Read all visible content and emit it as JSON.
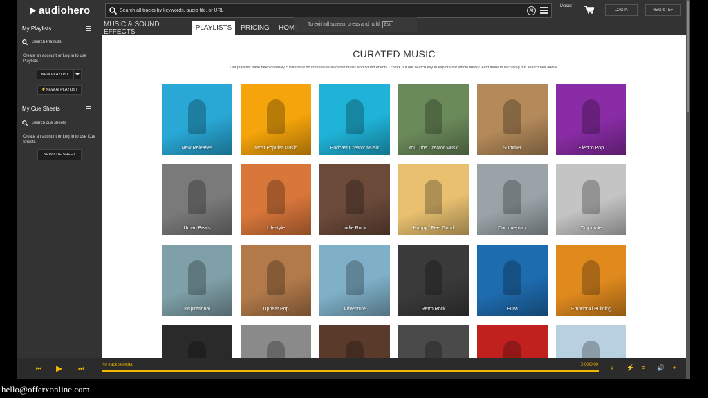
{
  "header": {
    "logo": "audiohero",
    "search_placeholder": "Search all tracks by keywords, audio file, or URL",
    "ai_label": "AI",
    "moods": "Moods",
    "login": "LOG IN",
    "register": "REGISTER"
  },
  "nav": {
    "tabs": [
      "MUSIC & SOUND EFFECTS",
      "PLAYLISTS",
      "PRICING",
      "HOME"
    ],
    "active": "PLAYLISTS"
  },
  "fullscreen_notice": {
    "text": "To exit full screen, press and hold",
    "key": "Esc"
  },
  "sidebar": {
    "playlists_title": "My Playlists",
    "playlists_search_placeholder": "Search Playlists",
    "playlists_text": "Create an account or Log in to use Playlists",
    "new_playlist": "NEW PLAYLIST",
    "new_ai_playlist": "NEW AI PLAYLIST",
    "cuesheets_title": "My Cue Sheets",
    "cuesheets_search_placeholder": "Search cue sheets",
    "cuesheets_text": "Create an account or Log in to use Cue Sheets",
    "new_cue_sheet": "NEW CUE SHEET"
  },
  "main": {
    "title": "CURATED MUSIC",
    "subtitle": "Our playlists have been carefully curated but do not include all of our music and sound effects - check out our search key to explore our whole library. Find more music using our search box above.",
    "playlists": [
      {
        "label": "New Releases",
        "bg": "#29a8d6"
      },
      {
        "label": "Most Popular Music",
        "bg": "#f5a40b"
      },
      {
        "label": "Podcast Creator Music",
        "bg": "#1fb3d8"
      },
      {
        "label": "YouTube Creator Music",
        "bg": "#6b8a5a"
      },
      {
        "label": "Summer",
        "bg": "#b48a5a"
      },
      {
        "label": "Electro Pop",
        "bg": "#8a2ca6"
      },
      {
        "label": "Urban Beats",
        "bg": "#7a7a7a"
      },
      {
        "label": "Lifestyle",
        "bg": "#d9763a"
      },
      {
        "label": "Indie Rock",
        "bg": "#6b4a3a"
      },
      {
        "label": "Happy / Feel Good",
        "bg": "#e8c070"
      },
      {
        "label": "Documentary",
        "bg": "#9aa4a8"
      },
      {
        "label": "Corporate",
        "bg": "#c4c4c4"
      },
      {
        "label": "Inspirational",
        "bg": "#7fa0a8"
      },
      {
        "label": "Upbeat Pop",
        "bg": "#b27a4a"
      },
      {
        "label": "Adventure",
        "bg": "#7fb0c8"
      },
      {
        "label": "Retro Rock",
        "bg": "#3a3a3a"
      },
      {
        "label": "EDM",
        "bg": "#1e6cb0"
      },
      {
        "label": "Emotional Building",
        "bg": "#e08a1e"
      },
      {
        "label": "",
        "bg": "#2a2a2a"
      },
      {
        "label": "",
        "bg": "#8a8a8a"
      },
      {
        "label": "",
        "bg": "#5a3a2a"
      },
      {
        "label": "",
        "bg": "#4a4a4a"
      },
      {
        "label": "",
        "bg": "#c0201e"
      },
      {
        "label": "",
        "bg": "#b8d0e0"
      }
    ]
  },
  "player": {
    "status": "No track selected",
    "time": "0:00/0:00",
    "accent": "#f1b700"
  },
  "footer_email": "hello@offerxonline.com"
}
